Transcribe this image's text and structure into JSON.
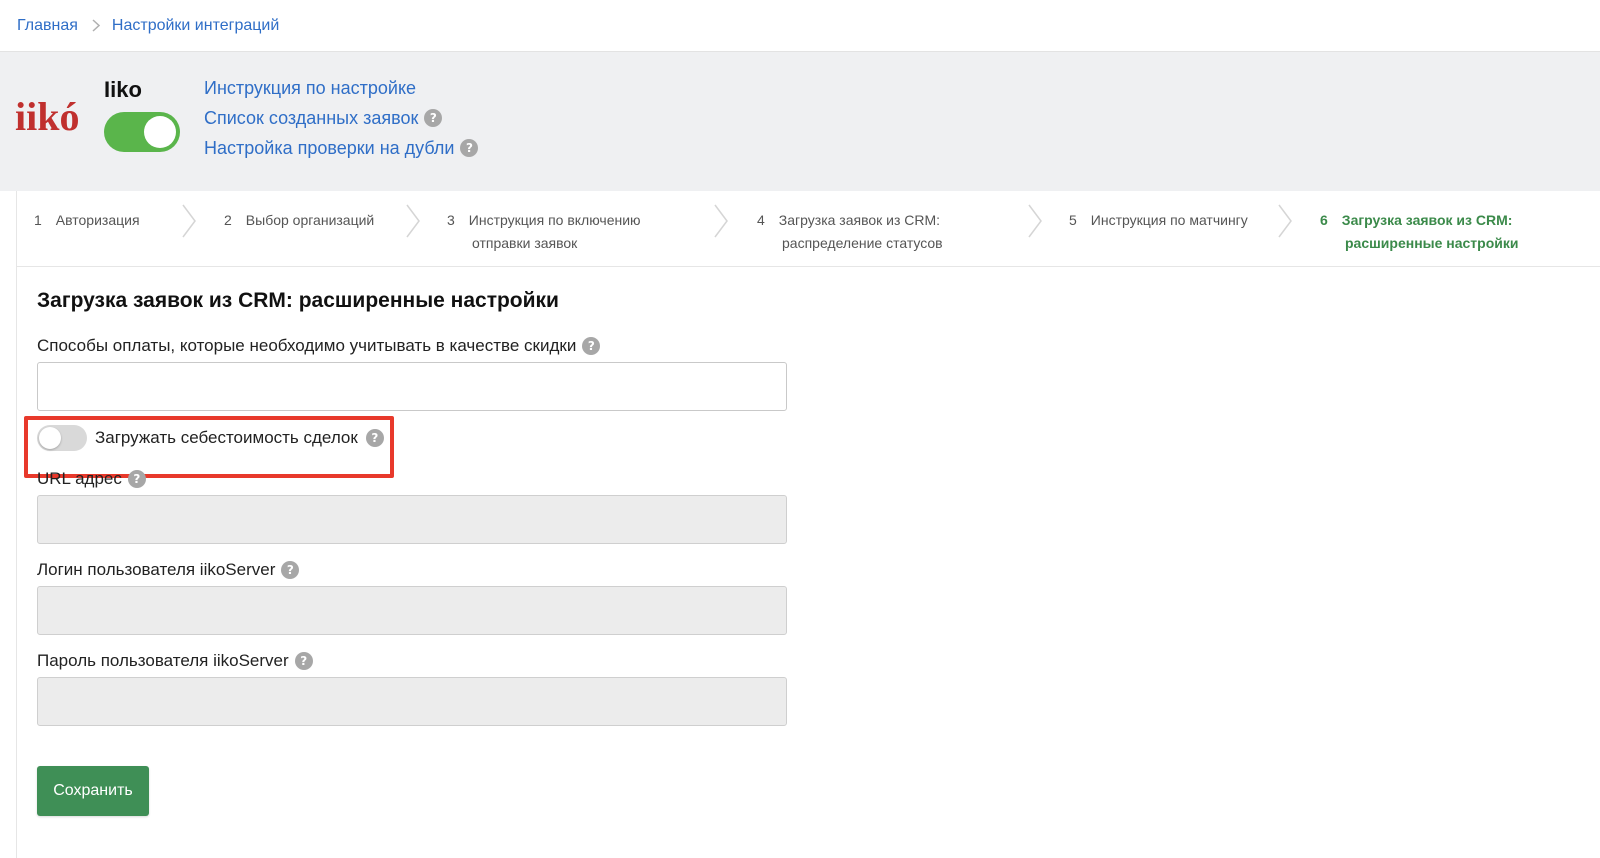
{
  "breadcrumbs": {
    "home": "Главная",
    "current": "Настройки интеграций"
  },
  "header": {
    "logo_text": "iikó",
    "title": "Iiko",
    "integration_enabled": true,
    "links": [
      {
        "label": "Инструкция по настройке",
        "help": false
      },
      {
        "label": "Список созданных заявок",
        "help": true
      },
      {
        "label": "Настройка проверки на дубли",
        "help": true
      }
    ]
  },
  "steps": [
    {
      "num": "1",
      "line1": "Авторизация",
      "line2": "",
      "active": false
    },
    {
      "num": "2",
      "line1": "Выбор организаций",
      "line2": "",
      "active": false
    },
    {
      "num": "3",
      "line1": "Инструкция по включению",
      "line2": "отправки заявок",
      "active": false
    },
    {
      "num": "4",
      "line1": "Загрузка заявок из CRM:",
      "line2": "распределение статусов",
      "active": false
    },
    {
      "num": "5",
      "line1": "Инструкция по матчингу",
      "line2": "",
      "active": false
    },
    {
      "num": "6",
      "line1": "Загрузка заявок из CRM:",
      "line2": "расширенные настройки",
      "active": true
    }
  ],
  "form": {
    "title": "Загрузка заявок из CRM: расширенные настройки",
    "payment_methods_label": "Способы оплаты, которые необходимо учитывать в качестве скидки",
    "payment_methods_value": "",
    "load_cost_label": "Загружать себестоимость сделок",
    "load_cost_enabled": false,
    "url_label": "URL адрес",
    "url_value": "",
    "login_label": "Логин пользователя iikoServer",
    "login_value": "",
    "password_label": "Пароль пользователя iikoServer",
    "password_value": "",
    "save_label": "Сохранить"
  },
  "colors": {
    "link": "#2f6ec7",
    "toggle_on": "#5ab54b",
    "active_step": "#3b8a4a",
    "save_button": "#3f8f56",
    "highlight": "#e8392b",
    "logo": "#c0302e"
  }
}
